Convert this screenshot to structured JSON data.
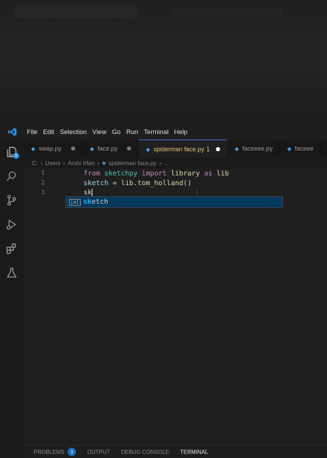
{
  "menu": [
    "File",
    "Edit",
    "Selection",
    "View",
    "Go",
    "Run",
    "Terminal",
    "Help"
  ],
  "explorer_badge": "5",
  "tabs": [
    {
      "label": "swap.py",
      "active": false
    },
    {
      "label": "face.py",
      "active": false
    },
    {
      "label": "spiderman face.py",
      "active": true,
      "problems": "1"
    },
    {
      "label": "faceeee.py",
      "active": false
    },
    {
      "label": "faceee",
      "active": false
    }
  ],
  "breadcrumb": {
    "path": [
      "C:",
      "Users",
      "Arshi Irfan",
      "spiderman face.py",
      "..."
    ]
  },
  "code": {
    "lines": [
      {
        "num": "1",
        "tokens": [
          [
            "kw",
            "from "
          ],
          [
            "mod",
            "sketchpy "
          ],
          [
            "kw",
            "import "
          ],
          [
            "txt",
            "library "
          ],
          [
            "kw",
            "as "
          ],
          [
            "txt",
            "lib"
          ]
        ]
      },
      {
        "num": "2",
        "tokens": [
          [
            "var",
            "sketch"
          ],
          [
            "op",
            " = "
          ],
          [
            "txt",
            "lib"
          ],
          [
            "op",
            "."
          ],
          [
            "fn",
            "tom_holland"
          ],
          [
            "op",
            "()"
          ]
        ]
      },
      {
        "num": "3",
        "tokens": [
          [
            "op",
            "sk"
          ]
        ]
      }
    ]
  },
  "suggest": {
    "kind": "[ø]",
    "match": "sk",
    "rest": "etch"
  },
  "panel": {
    "tabs": [
      {
        "label": "PROBLEMS",
        "badge": "1"
      },
      {
        "label": "OUTPUT"
      },
      {
        "label": "DEBUG CONSOLE"
      },
      {
        "label": "TERMINAL",
        "active": true
      }
    ]
  },
  "colors": {
    "accent": "#3a7bd5",
    "python_icon": "#4a9cd8",
    "modified_tab": "#e8c27a"
  }
}
